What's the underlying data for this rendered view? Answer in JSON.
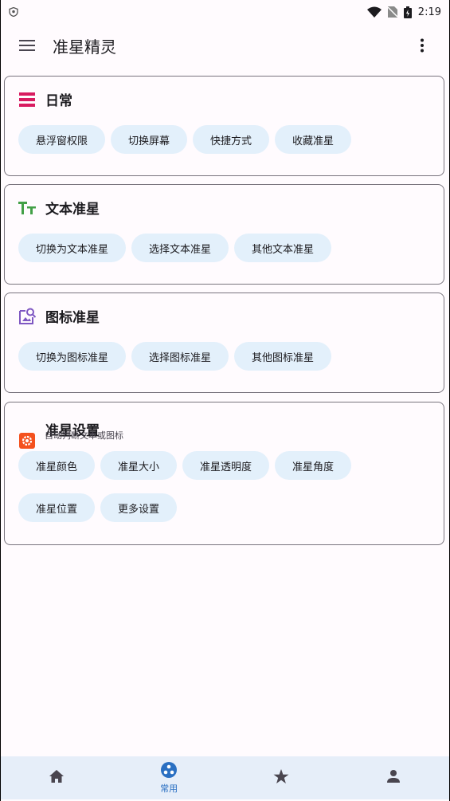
{
  "status_bar": {
    "time": "2:19",
    "icons": [
      "shield-icon",
      "wifi-icon",
      "no-sim-icon",
      "battery-icon"
    ]
  },
  "app_bar": {
    "title": "准星精灵",
    "icons": [
      "hamburger-menu-icon",
      "more-vert-icon"
    ]
  },
  "cards": [
    {
      "title": "日常",
      "icon": "daily-list-icon",
      "icon_color": "#d81b60",
      "chips": [
        "悬浮窗权限",
        "切换屏幕",
        "快捷方式",
        "收藏准星"
      ]
    },
    {
      "title": "文本准星",
      "icon": "text-format-icon",
      "icon_color": "#43a047",
      "chips": [
        "切换为文本准星",
        "选择文本准星",
        "其他文本准星"
      ]
    },
    {
      "title": "图标准星",
      "icon": "image-search-icon",
      "icon_color": "#7e57c2",
      "chips": [
        "切换为图标准星",
        "选择图标准星",
        "其他图标准星"
      ]
    },
    {
      "title": "准星设置",
      "subtitle": "自动判断文本或图标",
      "icon": "settings-gear-icon",
      "icon_color": "#f4511e",
      "chips": [
        "准星颜色",
        "准星大小",
        "准星透明度",
        "准星角度",
        "准星位置",
        "更多设置"
      ]
    }
  ],
  "bottom_nav": {
    "items": [
      {
        "icon": "home-icon",
        "label": ""
      },
      {
        "icon": "common-icon",
        "label": "常用",
        "selected": true
      },
      {
        "icon": "star-icon",
        "label": ""
      },
      {
        "icon": "person-icon",
        "label": ""
      }
    ],
    "accent_color": "#2a6fc2"
  },
  "colors": {
    "background": "#fffbfe",
    "chip_background": "#e3f0fb",
    "nav_background": "#e6eef9",
    "card_border": "#79747e"
  }
}
